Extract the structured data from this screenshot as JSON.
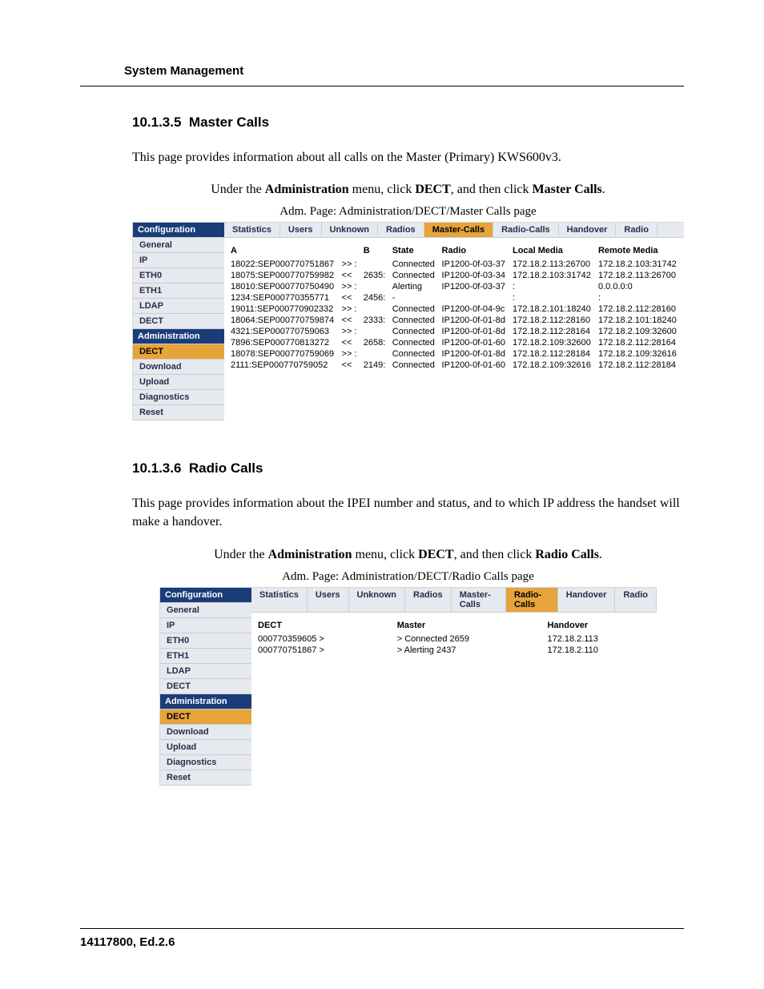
{
  "doc": {
    "header": "System Management",
    "footer": "14117800, Ed.2.6"
  },
  "section1": {
    "num": "10.1.3.5",
    "title": "Master Calls",
    "intro": "This page provides information about all calls on the Master (Primary) KWS600v3.",
    "nav_prefix": "Under the ",
    "nav_bold1": "Administration",
    "nav_mid1": " menu, click ",
    "nav_bold2": "DECT",
    "nav_mid2": ", and then click ",
    "nav_bold3": "Master Calls",
    "nav_end": ".",
    "caption": "Adm. Page: Administration/DECT/Master Calls page"
  },
  "section2": {
    "num": "10.1.3.6",
    "title": "Radio Calls",
    "intro": "This page provides information about the IPEI number and status, and to which IP address the handset will make a handover.",
    "nav_prefix": "Under the ",
    "nav_bold1": "Administration",
    "nav_mid1": " menu, click ",
    "nav_bold2": "DECT",
    "nav_mid2": ", and then click ",
    "nav_bold3": "Radio Calls",
    "nav_end": ".",
    "caption": "Adm. Page: Administration/DECT/Radio Calls page"
  },
  "sidebar": {
    "hdr1": "Configuration",
    "items1": [
      "General",
      "IP",
      "ETH0",
      "ETH1",
      "LDAP",
      "DECT"
    ],
    "hdr2": "Administration",
    "items2": [
      "DECT",
      "Download",
      "Upload",
      "Diagnostics",
      "Reset"
    ]
  },
  "tabs1": [
    "Statistics",
    "Users",
    "Unknown",
    "Radios",
    "Master-Calls",
    "Radio-Calls",
    "Handover",
    "Radio"
  ],
  "tabs1_active": 4,
  "tabs2": [
    "Statistics",
    "Users",
    "Unknown",
    "Radios",
    "Master-Calls",
    "Radio-Calls",
    "Handover",
    "Radio"
  ],
  "tabs2_active": 5,
  "table1": {
    "headers": [
      "A",
      "",
      "B",
      "State",
      "Radio",
      "Local Media",
      "Remote Media"
    ],
    "rows": [
      [
        "18022:SEP000770751867",
        ">> :",
        "",
        "Connected",
        "IP1200-0f-03-37",
        "172.18.2.113:26700",
        "172.18.2.103:31742"
      ],
      [
        "18075:SEP000770759982",
        "<<",
        "2635:",
        "Connected",
        "IP1200-0f-03-34",
        "172.18.2.103:31742",
        "172.18.2.113:26700"
      ],
      [
        "18010:SEP000770750490",
        ">> :",
        "",
        "Alerting",
        "IP1200-0f-03-37",
        ":",
        "0.0.0.0:0"
      ],
      [
        "1234:SEP000770355771",
        "<<",
        "2456:",
        "-",
        "",
        ":",
        ":"
      ],
      [
        "19011:SEP000770902332",
        ">> :",
        "",
        "Connected",
        "IP1200-0f-04-9c",
        "172.18.2.101:18240",
        "172.18.2.112:28160"
      ],
      [
        "18064:SEP000770759874",
        "<<",
        "2333:",
        "Connected",
        "IP1200-0f-01-8d",
        "172.18.2.112:28160",
        "172.18.2.101:18240"
      ],
      [
        "4321:SEP000770759063",
        ">> :",
        "",
        "Connected",
        "IP1200-0f-01-8d",
        "172.18.2.112:28164",
        "172.18.2.109:32600"
      ],
      [
        "7896:SEP000770813272",
        "<<",
        "2658:",
        "Connected",
        "IP1200-0f-01-60",
        "172.18.2.109:32600",
        "172.18.2.112:28164"
      ],
      [
        "18078:SEP000770759069",
        ">> :",
        "",
        "Connected",
        "IP1200-0f-01-8d",
        "172.18.2.112:28184",
        "172.18.2.109:32616"
      ],
      [
        "2111:SEP000770759052",
        "<<",
        "2149:",
        "Connected",
        "IP1200-0f-01-60",
        "172.18.2.109:32616",
        "172.18.2.112:28184"
      ]
    ]
  },
  "table2": {
    "headers": [
      "DECT",
      "Master",
      "Handover"
    ],
    "rows": [
      [
        "000770359605 >",
        "> Connected 2659",
        "172.18.2.113"
      ],
      [
        "000770751867 >",
        "> Alerting 2437",
        "172.18.2.110"
      ]
    ]
  }
}
